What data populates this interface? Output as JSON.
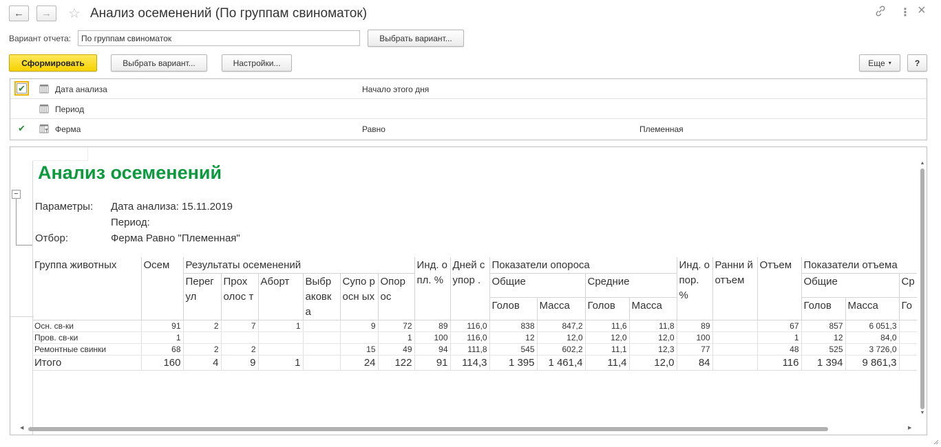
{
  "window": {
    "title": "Анализ осеменений (По группам свиноматок)",
    "back_icon": "←",
    "forward_icon": "→",
    "star_icon": "☆",
    "link_icon": "🔗",
    "menu_icon": "⋮",
    "close_icon": "×"
  },
  "variant": {
    "label": "Вариант отчета:",
    "value": "По группам свиноматок",
    "choose_button": "Выбрать вариант..."
  },
  "toolbar": {
    "generate": "Сформировать",
    "choose_variant": "Выбрать вариант...",
    "settings": "Настройки...",
    "more": "Еще",
    "help": "?"
  },
  "filters": [
    {
      "checked": true,
      "name": "Дата анализа",
      "condition": "Начало этого дня",
      "value": ""
    },
    {
      "checked": false,
      "name": "Период",
      "condition": "",
      "value": ""
    },
    {
      "checked": true,
      "name": "Ферма",
      "condition": "Равно",
      "value": "Племенная"
    }
  ],
  "report": {
    "title": "Анализ осеменений",
    "params_label": "Параметры:",
    "param1": "Дата анализа: 15.11.2019",
    "param2": "Период:",
    "filter_label": "Отбор:",
    "filter_value": "Ферма Равно \"Племенная\"",
    "collapse_icon": "−",
    "headers": {
      "group": "Группа животных",
      "osem": "Осем",
      "results": "Результаты осеменений",
      "pereg": "Перег ул",
      "prohol": "Прох олос т",
      "abort": "Аборт",
      "vybr": "Выбр аковк а",
      "supor": "Супо росн ых",
      "opor": "Опор ос",
      "ind_opl": "Инд. опл. %",
      "dney": "Дней супор .",
      "pokaz_opor": "Показатели опороса",
      "obshie": "Общие",
      "srednie": "Средние",
      "golov": "Голов",
      "massa": "Масса",
      "ind_opor": "Инд. опор. %",
      "ranniy": "Ранни й отъем",
      "otem": "Отъем",
      "pokaz_otem": "Показатели отъема",
      "obshie2": "Общие",
      "sr_cut": "Ср",
      "golov2": "Голов",
      "massa2": "Масса",
      "go_cut": "Го"
    },
    "rows": [
      {
        "group": "Осн. св-ки",
        "v": [
          "91",
          "2",
          "7",
          "1",
          "",
          "9",
          "72",
          "89",
          "116,0",
          "838",
          "847,2",
          "11,6",
          "11,8",
          "89",
          "",
          "67",
          "857",
          "6 051,3",
          ""
        ]
      },
      {
        "group": "Пров. св-ки",
        "v": [
          "1",
          "",
          "",
          "",
          "",
          "",
          "1",
          "100",
          "116,0",
          "12",
          "12,0",
          "12,0",
          "12,0",
          "100",
          "",
          "1",
          "12",
          "84,0",
          ""
        ]
      },
      {
        "group": "Ремонтные свинки",
        "v": [
          "68",
          "2",
          "2",
          "",
          "",
          "15",
          "49",
          "94",
          "111,8",
          "545",
          "602,2",
          "11,1",
          "12,3",
          "77",
          "",
          "48",
          "525",
          "3 726,0",
          ""
        ]
      }
    ],
    "total": {
      "group": "Итого",
      "v": [
        "160",
        "4",
        "9",
        "1",
        "",
        "24",
        "122",
        "91",
        "114,3",
        "1 395",
        "1 461,4",
        "11,4",
        "12,0",
        "84",
        "",
        "116",
        "1 394",
        "9 861,3",
        ""
      ]
    }
  }
}
